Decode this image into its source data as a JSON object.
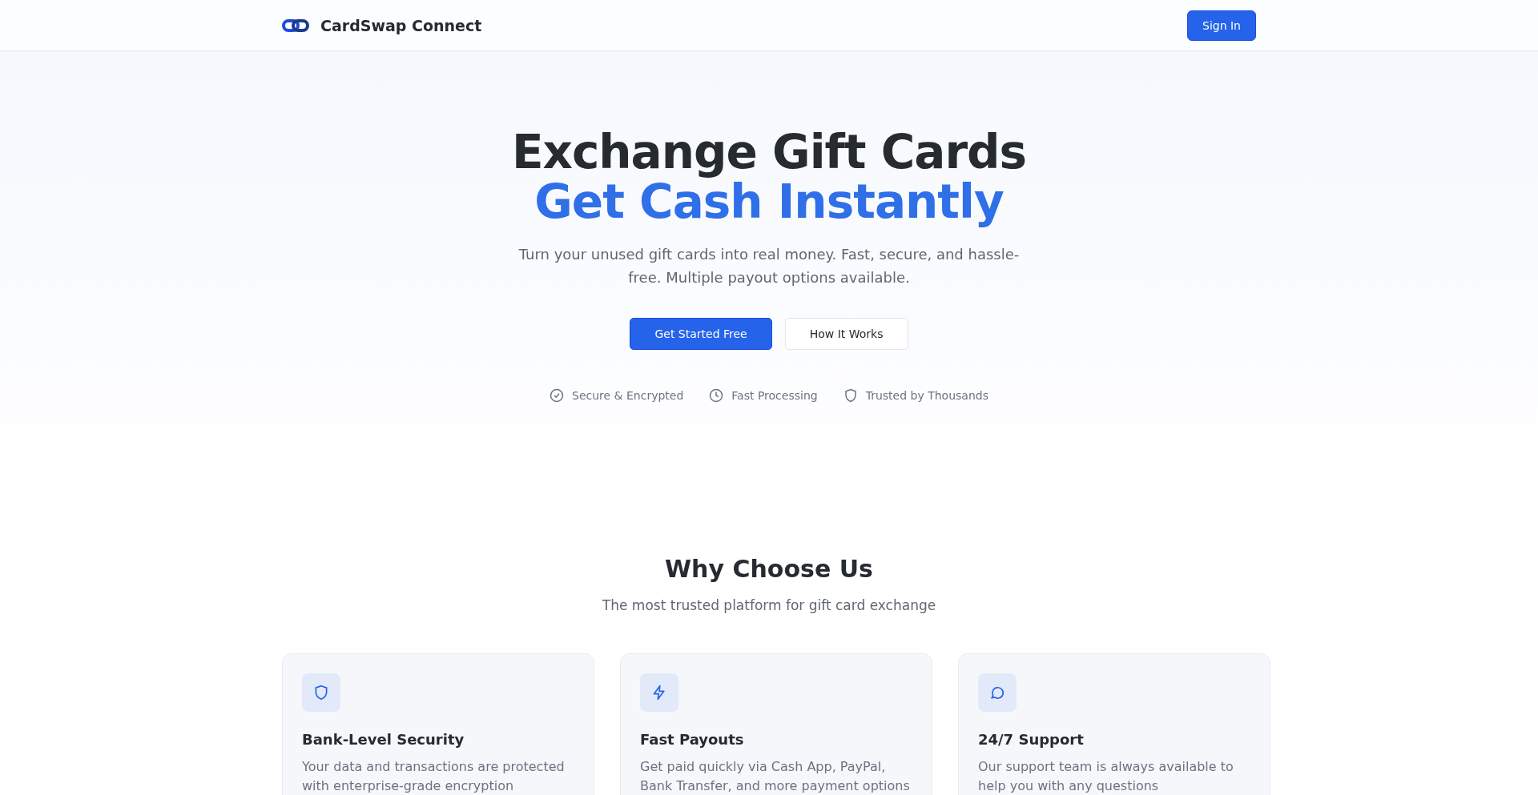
{
  "header": {
    "brand": "CardSwap Connect",
    "sign_in": "Sign In"
  },
  "hero": {
    "title": "Exchange Gift Cards",
    "title_accent": "Get Cash Instantly",
    "subtitle": "Turn your unused gift cards into real money. Fast, secure, and hassle-free. Multiple payout options available.",
    "buttons": [
      {
        "label": "Get Started Free",
        "kind": "primary"
      },
      {
        "label": "How It Works",
        "kind": "secondary"
      }
    ],
    "badges": [
      {
        "label": "Secure & Encrypted",
        "kind": "check"
      },
      {
        "label": "Fast Processing",
        "kind": "clock"
      },
      {
        "label": "Trusted by Thousands",
        "kind": "shield"
      }
    ]
  },
  "features": {
    "title": "Why Choose Us",
    "subtitle": "The most trusted platform for gift card exchange",
    "cards": [
      {
        "kind": "shield",
        "title": "Bank-Level Security",
        "text": "Your data and transactions are protected with enterprise-grade encryption"
      },
      {
        "kind": "bolt",
        "title": "Fast Payouts",
        "text": "Get paid quickly via Cash App, PayPal, Bank Transfer, and more payment options"
      },
      {
        "kind": "chat",
        "title": "24/7 Support",
        "text": "Our support team is always available to help you with any questions"
      }
    ]
  }
}
